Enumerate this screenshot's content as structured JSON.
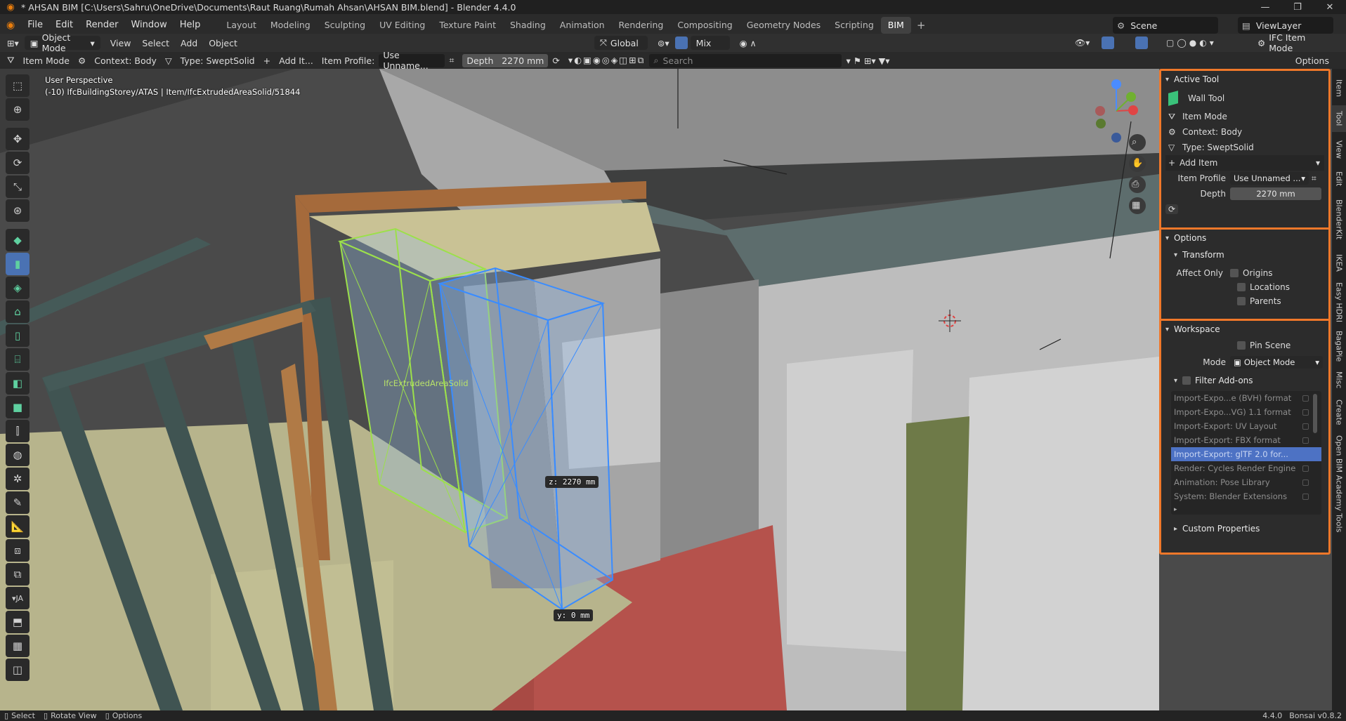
{
  "window": {
    "title": "* AHSAN BIM [C:\\Users\\Sahru\\OneDrive\\Documents\\Raut Ruang\\Rumah Ahsan\\AHSAN BIM.blend] - Blender 4.4.0"
  },
  "menu": [
    "File",
    "Edit",
    "Render",
    "Window",
    "Help"
  ],
  "workspaces": [
    "Layout",
    "Modeling",
    "Sculpting",
    "UV Editing",
    "Texture Paint",
    "Shading",
    "Animation",
    "Rendering",
    "Compositing",
    "Geometry Nodes",
    "Scripting",
    "BIM"
  ],
  "active_workspace": "BIM",
  "scene": "Scene",
  "view_layer": "ViewLayer",
  "header": {
    "mode": "Object Mode",
    "menus": [
      "View",
      "Select",
      "Add",
      "Object"
    ],
    "orientation": "Global",
    "snap": "Mix",
    "ifc_mode": "IFC Item Mode"
  },
  "tool_header": {
    "item_mode": "Item Mode",
    "context": "Context: Body",
    "type": "Type: SweptSolid",
    "add_item": "Add It...",
    "item_profile_label": "Item Profile:",
    "item_profile_value": "Use Unname...",
    "depth_label": "Depth",
    "depth_value": "2270 mm",
    "search_placeholder": "Search",
    "options": "Options"
  },
  "viewport": {
    "perspective": "User Perspective",
    "object_info": "(-10) IfcBuildingStorey/ATAS | Item/IfcExtrudedAreaSolid/51844",
    "object_label": "IfcExtrudedAreaSolid",
    "z_readout": "z: 2270 mm",
    "y_readout": "y: 0 mm",
    "collapse_label": "JA"
  },
  "panel": {
    "active_tool": {
      "title": "Active Tool",
      "tool_name": "Wall Tool",
      "item_mode": "Item Mode",
      "context": "Context: Body",
      "type": "Type: SweptSolid",
      "add_item": "Add Item",
      "item_profile_label": "Item Profile",
      "item_profile_value": "Use Unnamed ...",
      "depth_label": "Depth",
      "depth_value": "2270 mm"
    },
    "options": {
      "title": "Options",
      "transform": "Transform",
      "affect_only": "Affect Only",
      "origins": "Origins",
      "locations": "Locations",
      "parents": "Parents"
    },
    "workspace": {
      "title": "Workspace",
      "pin_scene": "Pin Scene",
      "mode_label": "Mode",
      "mode_value": "Object Mode",
      "filter_addons": "Filter Add-ons",
      "addons": [
        "Import-Expo...e (BVH) format",
        "Import-Expo...VG) 1.1 format",
        "Import-Export: UV Layout",
        "Import-Export: FBX format",
        "Import-Export: glTF 2.0 for...",
        "Render: Cycles Render Engine",
        "Animation: Pose Library",
        "System: Blender Extensions"
      ],
      "selected_addon": "Import-Export: glTF 2.0 for...",
      "custom_properties": "Custom Properties"
    }
  },
  "side_tabs": [
    "Item",
    "Tool",
    "View",
    "Edit",
    "BlenderKit",
    "IKEA",
    "Easy HDRI",
    "BagaPie",
    "Misc",
    "Create",
    "Open BIM Academy Tools"
  ],
  "status": {
    "select": "Select",
    "rotate": "Rotate View",
    "options": "Options",
    "version": "4.4.0",
    "addon_version": "Bonsai v0.8.2"
  },
  "colors": {
    "accent_orange": "#f0782a",
    "selection_blue": "#4d72c4",
    "active_tool_blue": "#4a72b3",
    "wireframe_green": "#9ce04a",
    "wireframe_blue": "#3a8cff"
  }
}
